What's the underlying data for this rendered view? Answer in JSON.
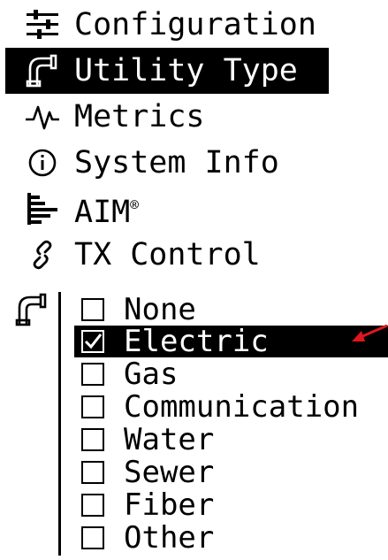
{
  "menu": {
    "items": [
      {
        "label": "Configuration",
        "icon": "sliders-icon"
      },
      {
        "label": "Utility Type",
        "icon": "pipe-icon",
        "selected": true
      },
      {
        "label": "Metrics",
        "icon": "pulse-icon"
      },
      {
        "label": "System Info",
        "icon": "info-icon"
      },
      {
        "label": "AIM",
        "trademark": "®",
        "icon": "bars-icon"
      },
      {
        "label": "TX Control",
        "icon": "link-icon"
      }
    ]
  },
  "submenu": {
    "icon": "pipe-icon",
    "options": [
      {
        "label": "None",
        "checked": false
      },
      {
        "label": "Electric",
        "checked": true
      },
      {
        "label": "Gas",
        "checked": false
      },
      {
        "label": "Communication",
        "checked": false
      },
      {
        "label": "Water",
        "checked": false
      },
      {
        "label": "Sewer",
        "checked": false
      },
      {
        "label": "Fiber",
        "checked": false
      },
      {
        "label": "Other",
        "checked": false
      }
    ]
  },
  "colors": {
    "foreground": "#000000",
    "background": "#ffffff",
    "highlight": "#000000",
    "annotation_arrow": "#e0161e"
  }
}
